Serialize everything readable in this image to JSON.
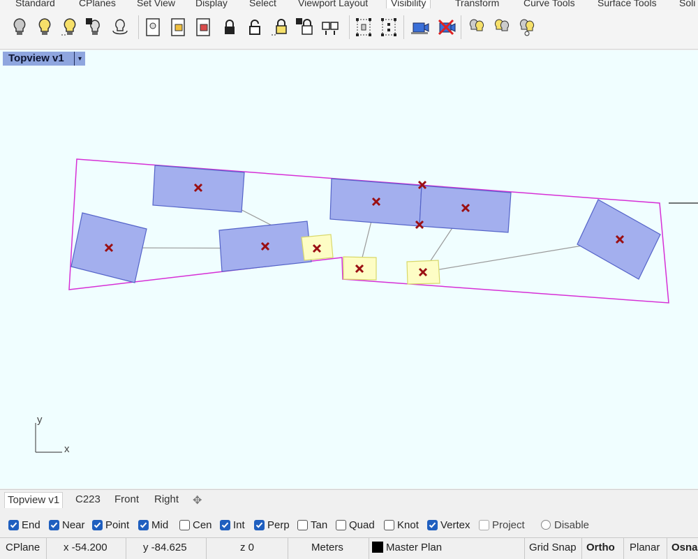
{
  "ribbon": {
    "tabs": [
      "Standard",
      "CPlanes",
      "Set View",
      "Display",
      "Select",
      "Viewport Layout",
      "Visibility",
      "Transform",
      "Curve Tools",
      "Surface Tools",
      "Soli"
    ],
    "active_tab": "Visibility"
  },
  "toolbar": {
    "icons": [
      "bulb-off-icon",
      "bulb-on-icon",
      "bulb-dotted-icon",
      "bulb-swap-icon",
      "bulb-arrows-icon",
      "doc-show-icon",
      "doc-box-icon",
      "doc-select-icon",
      "lock-icon",
      "lock-open-icon",
      "lock-selection-icon",
      "lock-swap-icon",
      "lock-objects-icon",
      "cage-dots-icon",
      "cage-grid-icon",
      "camera-blue-icon",
      "camera-cross-icon",
      "bulbs-pair-icon",
      "bulbs-split-icon",
      "bulb-ring-icon"
    ]
  },
  "viewport": {
    "title": "Topview v1",
    "axis_x": "x",
    "axis_y": "y",
    "colors": {
      "background": "#f0feff",
      "boundary": "#d62fd6",
      "block_fill": "#a3afee",
      "block_stroke": "#5463c8",
      "highlight_fill": "#fdfdc5",
      "highlight_stroke": "#d8d86a",
      "point": "#9a0f12",
      "link": "#9a9a9a"
    }
  },
  "view_tabs": [
    "Topview v1",
    "C223",
    "Front",
    "Right"
  ],
  "view_tabs_add_icon": "add-view-icon",
  "osnaps": [
    {
      "label": "End",
      "checked": true
    },
    {
      "label": "Near",
      "checked": true
    },
    {
      "label": "Point",
      "checked": true
    },
    {
      "label": "Mid",
      "checked": true
    },
    {
      "label": "Cen",
      "checked": false
    },
    {
      "label": "Int",
      "checked": true
    },
    {
      "label": "Perp",
      "checked": true
    },
    {
      "label": "Tan",
      "checked": false
    },
    {
      "label": "Quad",
      "checked": false
    },
    {
      "label": "Knot",
      "checked": false
    },
    {
      "label": "Vertex",
      "checked": true
    },
    {
      "label": "Project",
      "checked": false
    },
    {
      "label": "Disable",
      "checked": false
    }
  ],
  "status": {
    "cplane": "CPlane",
    "x": "x -54.200",
    "y": "y -84.625",
    "z": "z 0",
    "units": "Meters",
    "layer": "Master Plan",
    "grid_snap": "Grid Snap",
    "ortho": "Ortho",
    "planar": "Planar",
    "osnap": "Osnap"
  }
}
